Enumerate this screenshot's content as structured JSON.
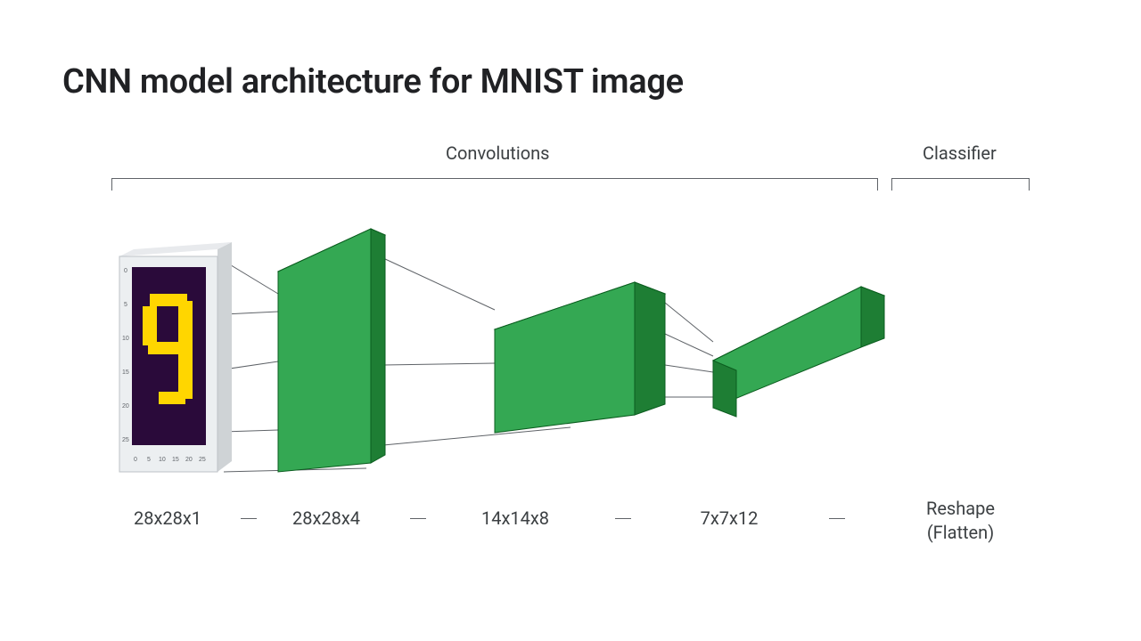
{
  "title": "CNN model architecture for MNIST image",
  "sections": {
    "convolutions": "Convolutions",
    "classifier": "Classifier"
  },
  "layers": {
    "input": {
      "dims": "28x28x1",
      "dims_values": [
        28,
        28,
        1
      ],
      "description": "Input image (MNIST digit)"
    },
    "conv1": {
      "dims": "28x28x4",
      "dims_values": [
        28,
        28,
        4
      ],
      "description": "Convolution layer 1 output"
    },
    "conv2": {
      "dims": "14x14x8",
      "dims_values": [
        14,
        14,
        8
      ],
      "description": "Convolution layer 2 output"
    },
    "conv3": {
      "dims": "7x7x12",
      "dims_values": [
        7,
        7,
        12
      ],
      "description": "Convolution layer 3 output"
    },
    "flatten": {
      "label_line1": "Reshape",
      "label_line2": "(Flatten)",
      "description": "Flatten layer"
    }
  },
  "input_sample": {
    "digit": "9",
    "axis_ticks": [
      "0",
      "5",
      "10",
      "15",
      "20",
      "25"
    ]
  },
  "colors": {
    "block_face_light": "#34a853",
    "block_face_mid": "#2c9147",
    "block_face_dark": "#1e7e34",
    "block_stroke": "#0b5d1f",
    "frame_light": "#eceff1",
    "frame_dark": "#cfd3d6",
    "image_bg": "#2a0a3a",
    "digit_fill": "#ffd600"
  }
}
